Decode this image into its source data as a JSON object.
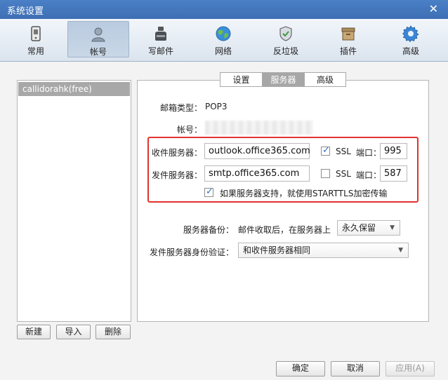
{
  "window": {
    "title": "系统设置",
    "close_glyph": "✕"
  },
  "toolbar": {
    "items": [
      {
        "label": "常用",
        "icon": "phone-icon"
      },
      {
        "label": "帐号",
        "icon": "person-icon"
      },
      {
        "label": "写邮件",
        "icon": "inkpot-icon"
      },
      {
        "label": "网络",
        "icon": "globe-icon"
      },
      {
        "label": "反垃圾",
        "icon": "shield-icon"
      },
      {
        "label": "插件",
        "icon": "box-icon"
      },
      {
        "label": "高级",
        "icon": "gear-icon"
      }
    ],
    "active_index": 1
  },
  "accounts": {
    "items": [
      "callidorahk(free)"
    ]
  },
  "left_buttons": {
    "new": "新建",
    "import": "导入",
    "delete": "删除"
  },
  "tabs": [
    {
      "label": "设置"
    },
    {
      "label": "服务器"
    },
    {
      "label": "高级"
    }
  ],
  "server": {
    "mailbox_type_label": "邮箱类型：",
    "mailbox_type_value": "POP3",
    "account_label": "帐号：",
    "incoming_label": "收件服务器：",
    "incoming_value": "outlook.office365.com",
    "incoming_ssl_checked": true,
    "ssl_label": "SSL",
    "port_label": "端口：",
    "incoming_port": "995",
    "outgoing_label": "发件服务器：",
    "outgoing_value": "smtp.office365.com",
    "outgoing_ssl_checked": false,
    "outgoing_port": "587",
    "starttls_checked": true,
    "starttls_label": "如果服务器支持，就使用STARTTLS加密传输",
    "backup_label": "服务器备份：",
    "backup_desc": "邮件收取后，在服务器上",
    "backup_value": "永久保留",
    "auth_label": "发件服务器身份验证：",
    "auth_value": "和收件服务器相同"
  },
  "footer": {
    "ok": "确定",
    "cancel": "取消",
    "apply": "应用(A)"
  },
  "colors": {
    "titlebar": "#4a80c6",
    "highlight_box": "#e2332f",
    "check": "#2a6fc4"
  }
}
